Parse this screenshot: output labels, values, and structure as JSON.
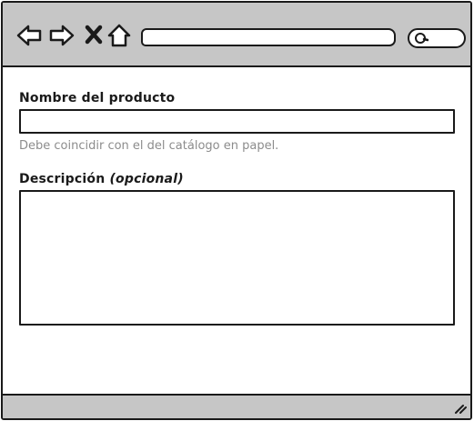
{
  "toolbar": {
    "nav_icons": [
      "back-arrow-icon",
      "forward-arrow-icon",
      "close-x-icon",
      "home-icon"
    ],
    "search_icon": "magnifier-icon"
  },
  "form": {
    "name_label": "Nombre del producto",
    "name_value": "",
    "name_helper": "Debe coincidir con el del catálogo en papel.",
    "description_label": "Descripción",
    "description_optional": "(opcional)",
    "description_value": ""
  },
  "colors": {
    "chrome": "#c6c6c6",
    "stroke": "#1a1a1a",
    "helper_text": "#8c8c8c"
  }
}
